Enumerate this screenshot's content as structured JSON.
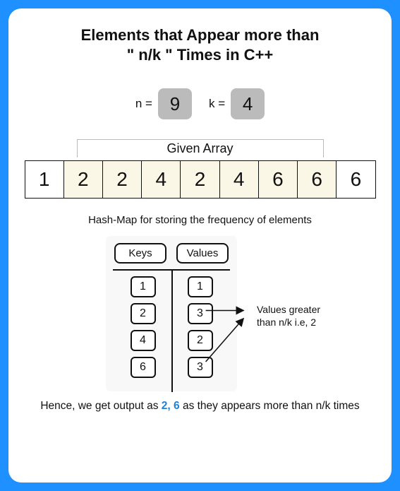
{
  "title_line1": "Elements that Appear more than",
  "title_line2": "\" n/k \" Times in C++",
  "params": {
    "n_label": "n =",
    "n_value": "9",
    "k_label": "k =",
    "k_value": "4"
  },
  "array": {
    "caption": "Given Array",
    "cells": [
      "1",
      "2",
      "2",
      "4",
      "2",
      "4",
      "6",
      "6",
      "6"
    ],
    "shaded": [
      1,
      2,
      3,
      4,
      5,
      6,
      7
    ]
  },
  "hashmap": {
    "caption": "Hash-Map for storing the frequency of elements",
    "keys_header": "Keys",
    "values_header": "Values",
    "keys": [
      "1",
      "2",
      "4",
      "6"
    ],
    "values": [
      "1",
      "3",
      "2",
      "3"
    ]
  },
  "annotation": {
    "line1": "Values greater",
    "line2": "than n/k i.e, 2"
  },
  "conclusion": {
    "prefix": "Hence, we get output as ",
    "output": "2, 6",
    "suffix": " as they appears more than n/k times"
  }
}
